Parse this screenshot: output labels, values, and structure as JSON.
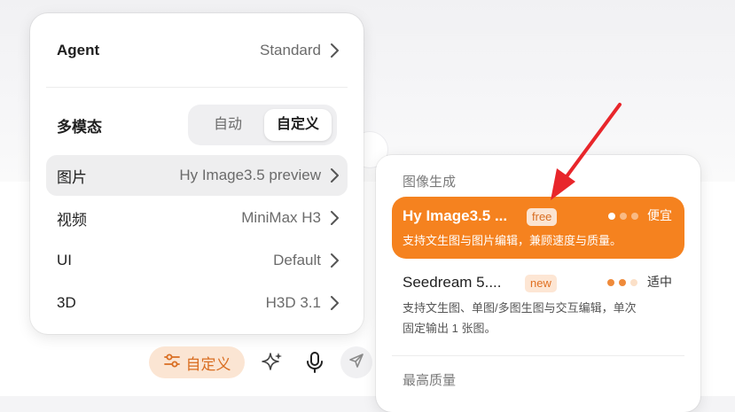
{
  "menu": {
    "agent": {
      "label": "Agent",
      "value": "Standard"
    },
    "multimodal": {
      "label": "多模态",
      "options": [
        "自动",
        "自定义"
      ],
      "selected": "自定义"
    },
    "items": [
      {
        "label": "图片",
        "value": "Hy Image3.5 preview",
        "selected": true
      },
      {
        "label": "视频",
        "value": "MiniMax H3",
        "selected": false
      },
      {
        "label": "UI",
        "value": "Default",
        "selected": false
      },
      {
        "label": "3D",
        "value": "H3D 3.1",
        "selected": false
      }
    ]
  },
  "toolbar": {
    "custom_label": "自定义",
    "icons": [
      "sliders-icon",
      "sparkle-icon",
      "mic-icon",
      "send-icon"
    ]
  },
  "dropdown": {
    "section_image": "图像生成",
    "models": [
      {
        "name": "Hy Image3.5 ...",
        "badge": "free",
        "speed_label": "便宜",
        "speed_level": 1,
        "description": [
          "支持文生图与图片编辑，兼顾速度与质量。"
        ],
        "active": true
      },
      {
        "name": "Seedream 5....",
        "badge": "new",
        "speed_label": "适中",
        "speed_level": 2,
        "description": [
          "支持文生图、单图/多图生图与交互编辑，单次",
          "固定输出 1 张图。"
        ],
        "active": false
      }
    ],
    "section_quality": "最高质量"
  },
  "colors": {
    "accent": "#f5821f",
    "accent_soft": "#fbe5d3",
    "accent_text": "#d96e22",
    "arrow": "#e8262b"
  }
}
